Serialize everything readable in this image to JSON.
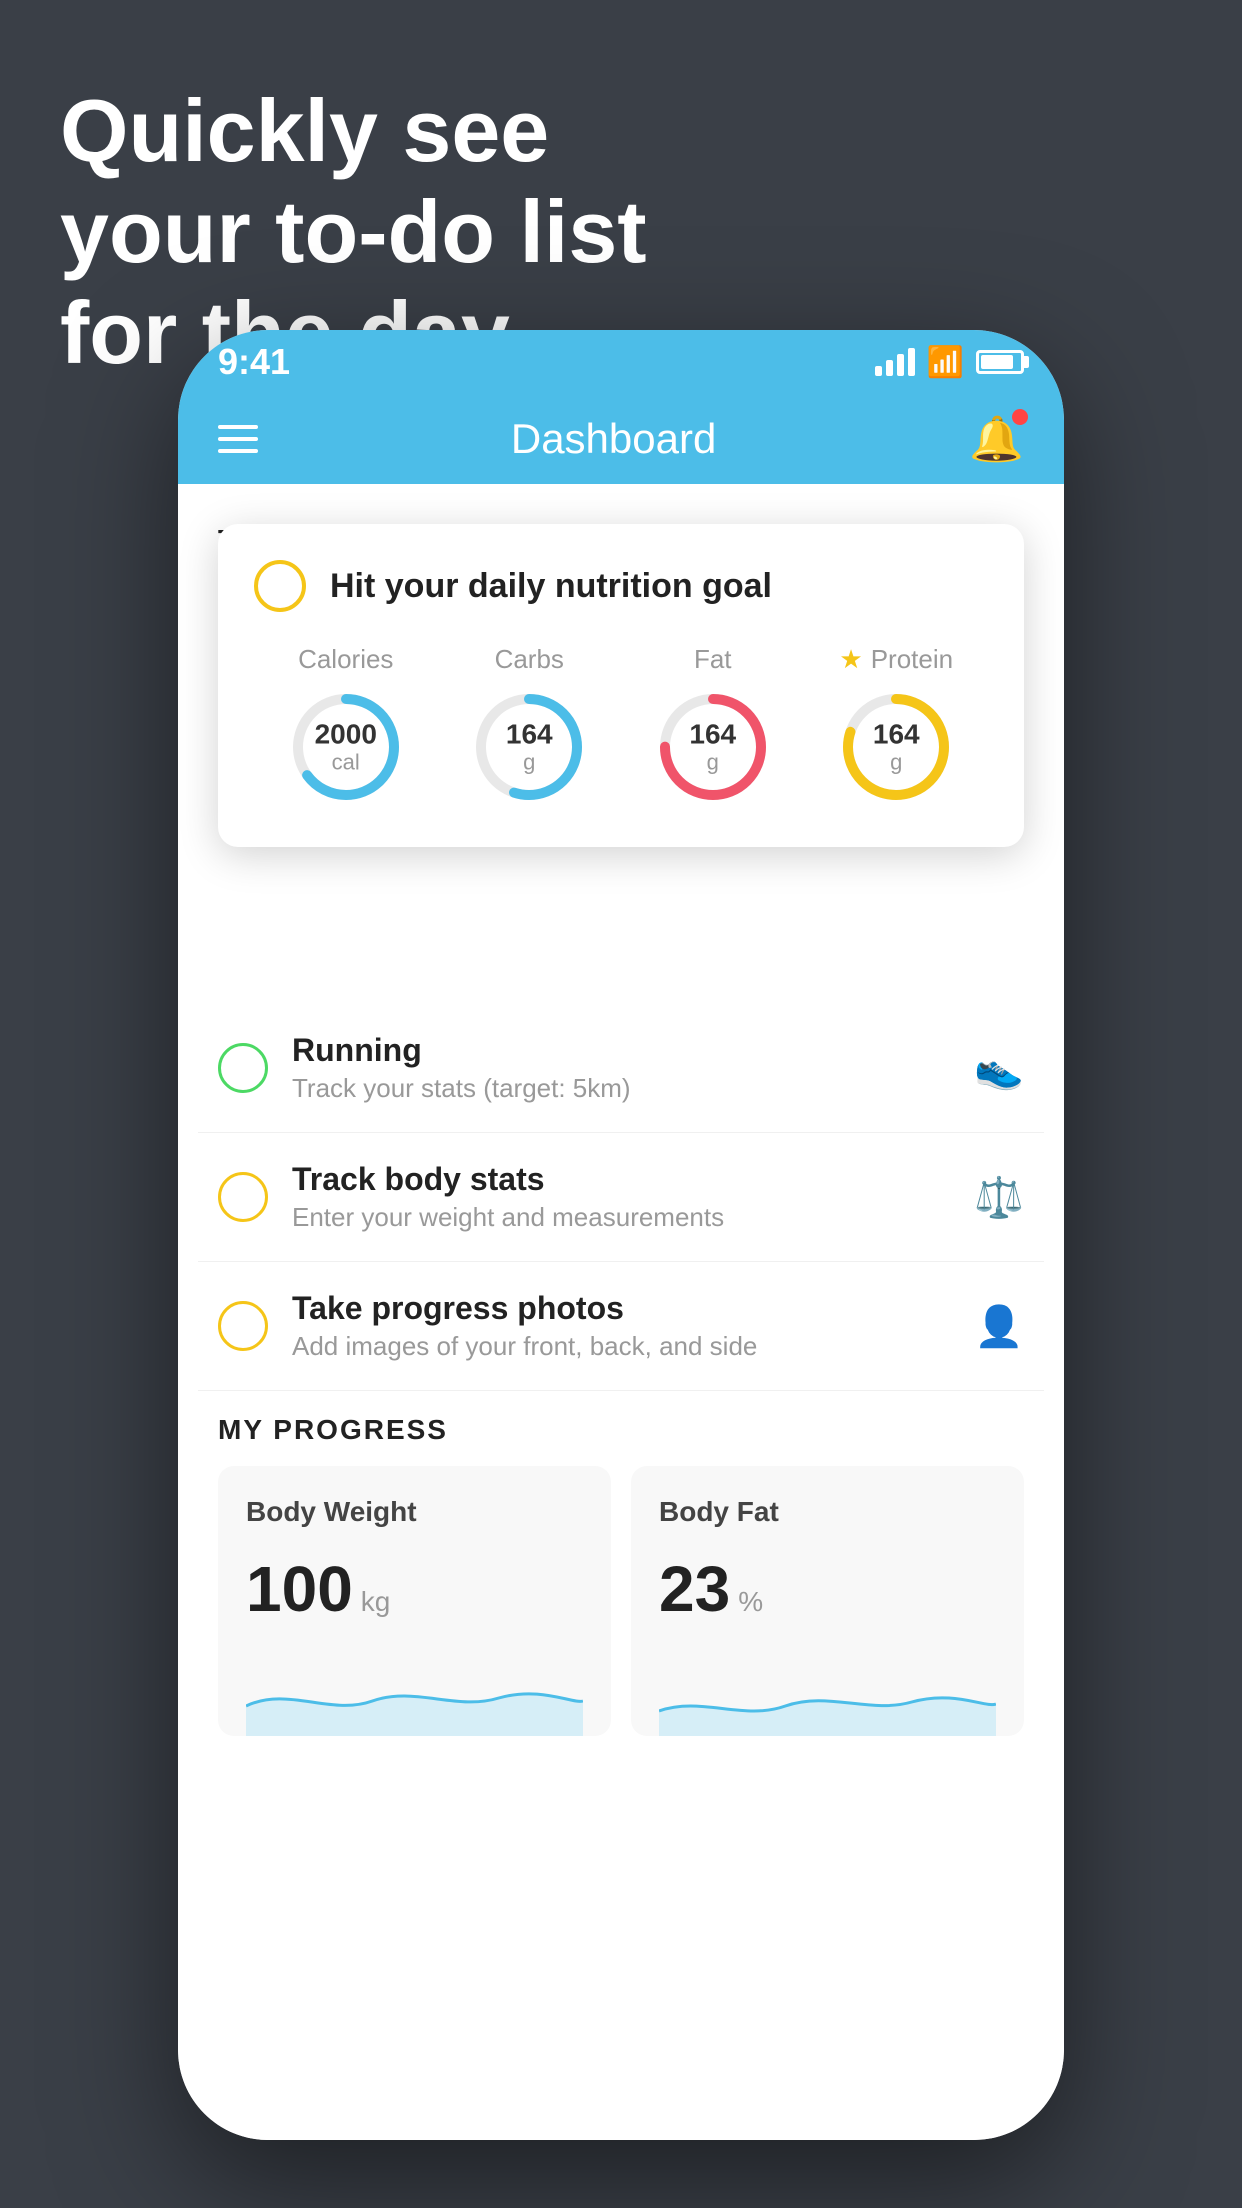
{
  "headline": {
    "line1": "Quickly see",
    "line2": "your to-do list",
    "line3": "for the day."
  },
  "phone": {
    "status_bar": {
      "time": "9:41",
      "signal_bars": [
        10,
        16,
        22,
        28
      ],
      "wifi": "wifi",
      "battery_pct": 85
    },
    "nav": {
      "title": "Dashboard"
    },
    "section_title": "THINGS TO DO TODAY",
    "floating_card": {
      "check_label": "Hit your daily nutrition goal",
      "stats": [
        {
          "label": "Calories",
          "value": "2000",
          "unit": "cal",
          "color": "#4cbde8",
          "pct": 65,
          "starred": false
        },
        {
          "label": "Carbs",
          "value": "164",
          "unit": "g",
          "color": "#4cbde8",
          "pct": 55,
          "starred": false
        },
        {
          "label": "Fat",
          "value": "164",
          "unit": "g",
          "color": "#f0546a",
          "pct": 75,
          "starred": false
        },
        {
          "label": "Protein",
          "value": "164",
          "unit": "g",
          "color": "#f5c518",
          "pct": 80,
          "starred": true
        }
      ]
    },
    "todo_items": [
      {
        "title": "Running",
        "subtitle": "Track your stats (target: 5km)",
        "circle_color": "green",
        "icon": "🥾"
      },
      {
        "title": "Track body stats",
        "subtitle": "Enter your weight and measurements",
        "circle_color": "yellow",
        "icon": "⚖"
      },
      {
        "title": "Take progress photos",
        "subtitle": "Add images of your front, back, and side",
        "circle_color": "yellow",
        "icon": "👤"
      }
    ],
    "progress": {
      "section_title": "MY PROGRESS",
      "cards": [
        {
          "title": "Body Weight",
          "value": "100",
          "unit": "kg"
        },
        {
          "title": "Body Fat",
          "value": "23",
          "unit": "%"
        }
      ]
    }
  }
}
